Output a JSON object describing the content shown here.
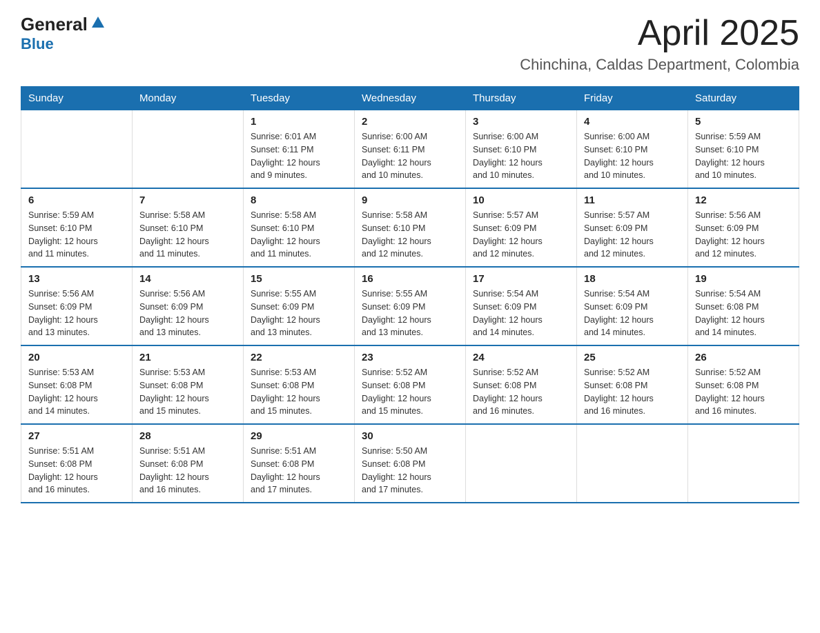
{
  "logo": {
    "general": "General",
    "blue": "Blue",
    "tagline": "Blue"
  },
  "title": "April 2025",
  "subtitle": "Chinchina, Caldas Department, Colombia",
  "days_of_week": [
    "Sunday",
    "Monday",
    "Tuesday",
    "Wednesday",
    "Thursday",
    "Friday",
    "Saturday"
  ],
  "weeks": [
    [
      {
        "day": "",
        "info": ""
      },
      {
        "day": "",
        "info": ""
      },
      {
        "day": "1",
        "info": "Sunrise: 6:01 AM\nSunset: 6:11 PM\nDaylight: 12 hours\nand 9 minutes."
      },
      {
        "day": "2",
        "info": "Sunrise: 6:00 AM\nSunset: 6:11 PM\nDaylight: 12 hours\nand 10 minutes."
      },
      {
        "day": "3",
        "info": "Sunrise: 6:00 AM\nSunset: 6:10 PM\nDaylight: 12 hours\nand 10 minutes."
      },
      {
        "day": "4",
        "info": "Sunrise: 6:00 AM\nSunset: 6:10 PM\nDaylight: 12 hours\nand 10 minutes."
      },
      {
        "day": "5",
        "info": "Sunrise: 5:59 AM\nSunset: 6:10 PM\nDaylight: 12 hours\nand 10 minutes."
      }
    ],
    [
      {
        "day": "6",
        "info": "Sunrise: 5:59 AM\nSunset: 6:10 PM\nDaylight: 12 hours\nand 11 minutes."
      },
      {
        "day": "7",
        "info": "Sunrise: 5:58 AM\nSunset: 6:10 PM\nDaylight: 12 hours\nand 11 minutes."
      },
      {
        "day": "8",
        "info": "Sunrise: 5:58 AM\nSunset: 6:10 PM\nDaylight: 12 hours\nand 11 minutes."
      },
      {
        "day": "9",
        "info": "Sunrise: 5:58 AM\nSunset: 6:10 PM\nDaylight: 12 hours\nand 12 minutes."
      },
      {
        "day": "10",
        "info": "Sunrise: 5:57 AM\nSunset: 6:09 PM\nDaylight: 12 hours\nand 12 minutes."
      },
      {
        "day": "11",
        "info": "Sunrise: 5:57 AM\nSunset: 6:09 PM\nDaylight: 12 hours\nand 12 minutes."
      },
      {
        "day": "12",
        "info": "Sunrise: 5:56 AM\nSunset: 6:09 PM\nDaylight: 12 hours\nand 12 minutes."
      }
    ],
    [
      {
        "day": "13",
        "info": "Sunrise: 5:56 AM\nSunset: 6:09 PM\nDaylight: 12 hours\nand 13 minutes."
      },
      {
        "day": "14",
        "info": "Sunrise: 5:56 AM\nSunset: 6:09 PM\nDaylight: 12 hours\nand 13 minutes."
      },
      {
        "day": "15",
        "info": "Sunrise: 5:55 AM\nSunset: 6:09 PM\nDaylight: 12 hours\nand 13 minutes."
      },
      {
        "day": "16",
        "info": "Sunrise: 5:55 AM\nSunset: 6:09 PM\nDaylight: 12 hours\nand 13 minutes."
      },
      {
        "day": "17",
        "info": "Sunrise: 5:54 AM\nSunset: 6:09 PM\nDaylight: 12 hours\nand 14 minutes."
      },
      {
        "day": "18",
        "info": "Sunrise: 5:54 AM\nSunset: 6:09 PM\nDaylight: 12 hours\nand 14 minutes."
      },
      {
        "day": "19",
        "info": "Sunrise: 5:54 AM\nSunset: 6:08 PM\nDaylight: 12 hours\nand 14 minutes."
      }
    ],
    [
      {
        "day": "20",
        "info": "Sunrise: 5:53 AM\nSunset: 6:08 PM\nDaylight: 12 hours\nand 14 minutes."
      },
      {
        "day": "21",
        "info": "Sunrise: 5:53 AM\nSunset: 6:08 PM\nDaylight: 12 hours\nand 15 minutes."
      },
      {
        "day": "22",
        "info": "Sunrise: 5:53 AM\nSunset: 6:08 PM\nDaylight: 12 hours\nand 15 minutes."
      },
      {
        "day": "23",
        "info": "Sunrise: 5:52 AM\nSunset: 6:08 PM\nDaylight: 12 hours\nand 15 minutes."
      },
      {
        "day": "24",
        "info": "Sunrise: 5:52 AM\nSunset: 6:08 PM\nDaylight: 12 hours\nand 16 minutes."
      },
      {
        "day": "25",
        "info": "Sunrise: 5:52 AM\nSunset: 6:08 PM\nDaylight: 12 hours\nand 16 minutes."
      },
      {
        "day": "26",
        "info": "Sunrise: 5:52 AM\nSunset: 6:08 PM\nDaylight: 12 hours\nand 16 minutes."
      }
    ],
    [
      {
        "day": "27",
        "info": "Sunrise: 5:51 AM\nSunset: 6:08 PM\nDaylight: 12 hours\nand 16 minutes."
      },
      {
        "day": "28",
        "info": "Sunrise: 5:51 AM\nSunset: 6:08 PM\nDaylight: 12 hours\nand 16 minutes."
      },
      {
        "day": "29",
        "info": "Sunrise: 5:51 AM\nSunset: 6:08 PM\nDaylight: 12 hours\nand 17 minutes."
      },
      {
        "day": "30",
        "info": "Sunrise: 5:50 AM\nSunset: 6:08 PM\nDaylight: 12 hours\nand 17 minutes."
      },
      {
        "day": "",
        "info": ""
      },
      {
        "day": "",
        "info": ""
      },
      {
        "day": "",
        "info": ""
      }
    ]
  ]
}
